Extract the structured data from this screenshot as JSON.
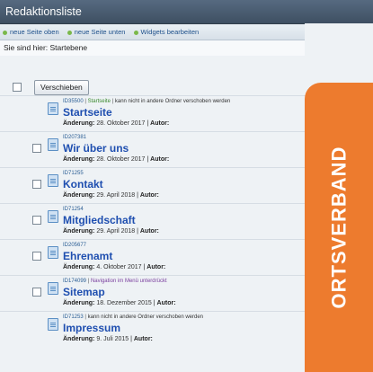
{
  "window": {
    "title": "Redaktionsliste"
  },
  "toolbar": {
    "items": [
      "neue Seite oben",
      "neue Seite unten",
      "Widgets bearbeiten"
    ]
  },
  "breadcrumb": "Sie sind hier: Startebene",
  "move_button": "Verschieben",
  "pages": [
    {
      "id": "ID35500",
      "status": "Startseite",
      "note": "kann nicht in andere Ordner verschoben werden",
      "title": "Startseite",
      "change_label": "Änderung:",
      "change_date": "28. Oktober 2017",
      "author_label": "Autor:",
      "checkbox": false
    },
    {
      "id": "ID207381",
      "title": "Wir über uns",
      "change_label": "Änderung:",
      "change_date": "28. Oktober 2017",
      "author_label": "Autor:",
      "checkbox": true
    },
    {
      "id": "ID71255",
      "title": "Kontakt",
      "change_label": "Änderung:",
      "change_date": "29. April 2018",
      "author_label": "Autor:",
      "checkbox": true
    },
    {
      "id": "ID71254",
      "title": "Mitgliedschaft",
      "change_label": "Änderung:",
      "change_date": "29. April 2018",
      "author_label": "Autor:",
      "checkbox": true
    },
    {
      "id": "ID205677",
      "title": "Ehrenamt",
      "change_label": "Änderung:",
      "change_date": "4. Oktober 2017",
      "author_label": "Autor:",
      "checkbox": true
    },
    {
      "id": "ID174099",
      "status": "Navigation im Menü unterdrückt",
      "title": "Sitemap",
      "change_label": "Änderung:",
      "change_date": "18. Dezember 2015",
      "author_label": "Autor:",
      "checkbox": true
    },
    {
      "id": "ID71253",
      "note": "kann nicht in andere Ordner verschoben werden",
      "title": "Impressum",
      "change_label": "Änderung:",
      "change_date": "9. Juli 2015",
      "author_label": "Autor:",
      "checkbox": false
    }
  ],
  "side_tag": {
    "label": "ORTSVERBAND",
    "color": "#ed7b2e"
  }
}
